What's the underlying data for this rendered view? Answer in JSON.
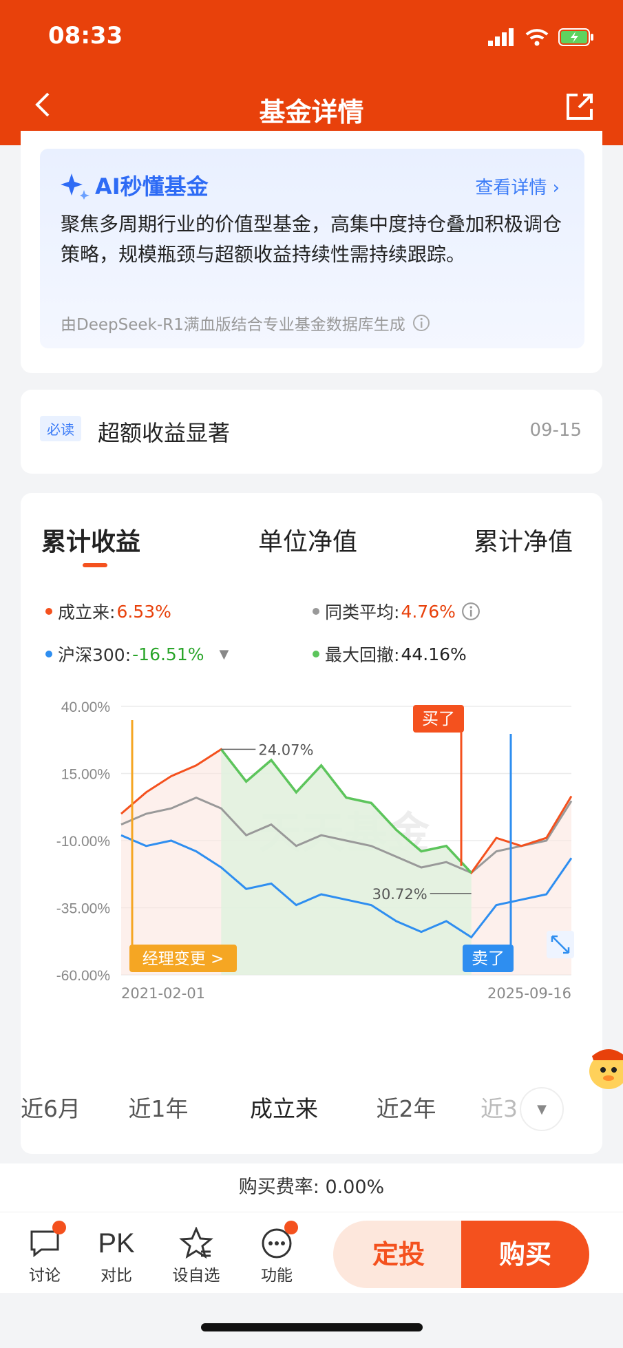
{
  "status": {
    "time": "08:33"
  },
  "header": {
    "title": "基金详情"
  },
  "ai": {
    "title": "AI秒懂基金",
    "more": "查看详情",
    "text": "聚焦多周期行业的价值型基金，高集中度持仓叠加积极调仓策略，规模瓶颈与超额收益持续性需持续跟踪。",
    "note": "由DeepSeek-R1满血版结合专业基金数据库生成"
  },
  "news": {
    "tag": "必读",
    "title": "超额收益显著",
    "date": "09-15"
  },
  "chart_tabs": [
    "累计收益",
    "单位净值",
    "累计净值"
  ],
  "legend": {
    "since_inception": {
      "label": "成立来:",
      "value": "6.53%",
      "color": "#f4511e"
    },
    "peer_avg": {
      "label": "同类平均:",
      "value": "4.76%",
      "color": "#999999"
    },
    "hs300": {
      "label": "沪深300:",
      "value": "-16.51%",
      "color": "#2e8ef0"
    },
    "max_drawdown": {
      "label": "最大回撤:",
      "value": "44.16%",
      "color": "#5cc55c"
    }
  },
  "chart_data": {
    "type": "line",
    "y_ticks": [
      "40.00%",
      "15.00%",
      "-10.00%",
      "-35.00%",
      "-60.00%"
    ],
    "ylim": [
      -60,
      40
    ],
    "x_start": "2021-02-01",
    "x_end": "2025-09-16",
    "x": [
      "2021-02",
      "2021-05",
      "2021-08",
      "2021-11",
      "2022-02",
      "2022-05",
      "2022-08",
      "2022-11",
      "2023-02",
      "2023-05",
      "2023-08",
      "2023-11",
      "2024-02",
      "2024-05",
      "2024-08",
      "2024-11",
      "2025-02",
      "2025-05",
      "2025-09"
    ],
    "series": [
      {
        "name": "成立来",
        "color": "#f4511e",
        "values": [
          0,
          8,
          14,
          18,
          24,
          12,
          20,
          8,
          18,
          6,
          4,
          -6,
          -14,
          -12,
          -22,
          -9,
          -12,
          -9,
          6.53
        ]
      },
      {
        "name": "同类平均",
        "color": "#999999",
        "values": [
          -4,
          0,
          2,
          6,
          2,
          -8,
          -4,
          -12,
          -8,
          -10,
          -12,
          -16,
          -20,
          -18,
          -22,
          -14,
          -12,
          -10,
          4.76
        ]
      },
      {
        "name": "沪深300",
        "color": "#2e8ef0",
        "values": [
          -8,
          -12,
          -10,
          -14,
          -20,
          -28,
          -26,
          -34,
          -30,
          -32,
          -34,
          -40,
          -44,
          -40,
          -46,
          -34,
          -32,
          -30,
          -16.51
        ]
      }
    ],
    "annotations": {
      "peak": "24.07%",
      "trough": "30.72%",
      "manager_change": "经理变更 >",
      "bought": "买了",
      "sold": "卖了"
    },
    "watermark": "天天基金"
  },
  "time_tabs": [
    "近6月",
    "近1年",
    "成立来",
    "近2年",
    "近3"
  ],
  "fee": "购买费率: 0.00%",
  "bottom": {
    "discuss": "讨论",
    "compare_icon": "PK",
    "compare": "对比",
    "watchlist": "设自选",
    "functions": "功能",
    "sip": "定投",
    "buy": "购买"
  }
}
